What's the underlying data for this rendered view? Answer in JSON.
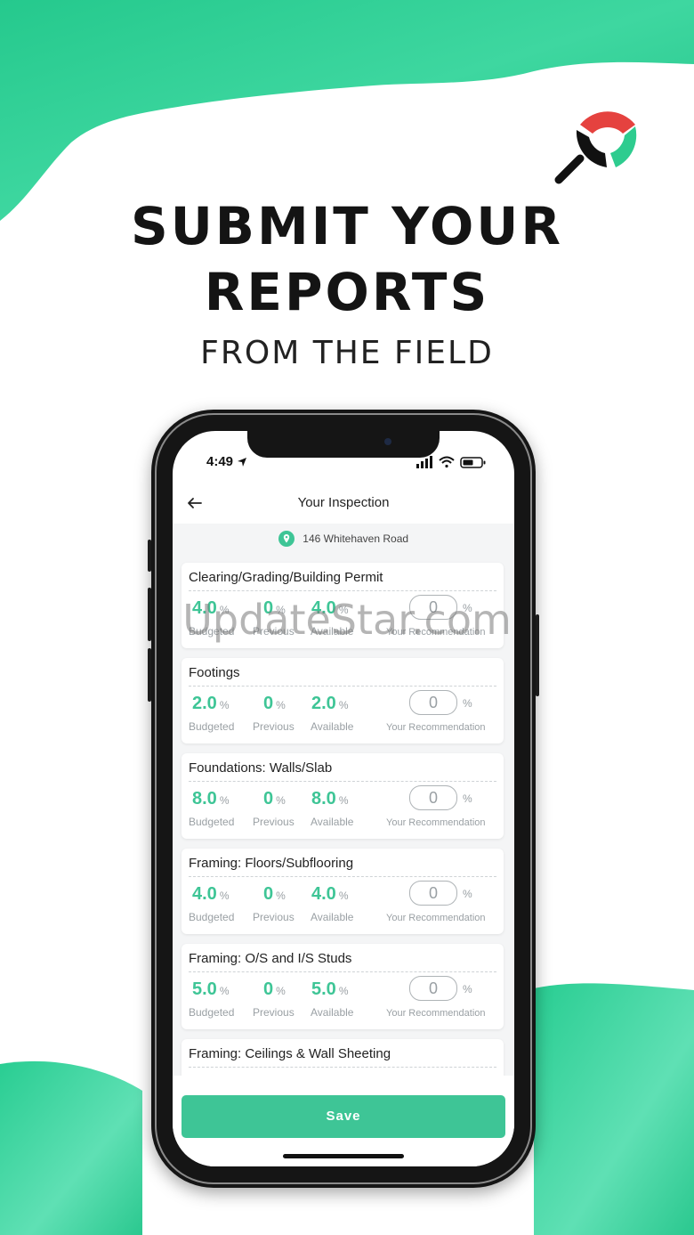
{
  "headline": {
    "line1": "SUBMIT YOUR",
    "line2": "REPORTS",
    "subline": "FROM THE FIELD"
  },
  "status_bar": {
    "time": "4:49"
  },
  "header": {
    "title": "Your Inspection"
  },
  "address": "146 Whitehaven Road",
  "labels": {
    "budgeted": "Budgeted",
    "previous": "Previous",
    "available": "Available",
    "recommendation": "Your Recommendation",
    "percent": "%"
  },
  "items": [
    {
      "title": "Clearing/Grading/Building Permit",
      "budgeted": "4.0",
      "previous": "0",
      "available": "4.0",
      "recommendation": "0"
    },
    {
      "title": "Footings",
      "budgeted": "2.0",
      "previous": "0",
      "available": "2.0",
      "recommendation": "0"
    },
    {
      "title": "Foundations: Walls/Slab",
      "budgeted": "8.0",
      "previous": "0",
      "available": "8.0",
      "recommendation": "0"
    },
    {
      "title": "Framing: Floors/Subflooring",
      "budgeted": "4.0",
      "previous": "0",
      "available": "4.0",
      "recommendation": "0"
    },
    {
      "title": "Framing: O/S and I/S Studs",
      "budgeted": "5.0",
      "previous": "0",
      "available": "5.0",
      "recommendation": "0"
    },
    {
      "title": "Framing: Ceilings & Wall Sheeting"
    }
  ],
  "save_label": "Save",
  "watermark": "UpdateStar.com",
  "colors": {
    "accent": "#3ec596",
    "wave": "#2fcf97",
    "logo_red": "#e5423f",
    "logo_green": "#2ecc8f"
  }
}
